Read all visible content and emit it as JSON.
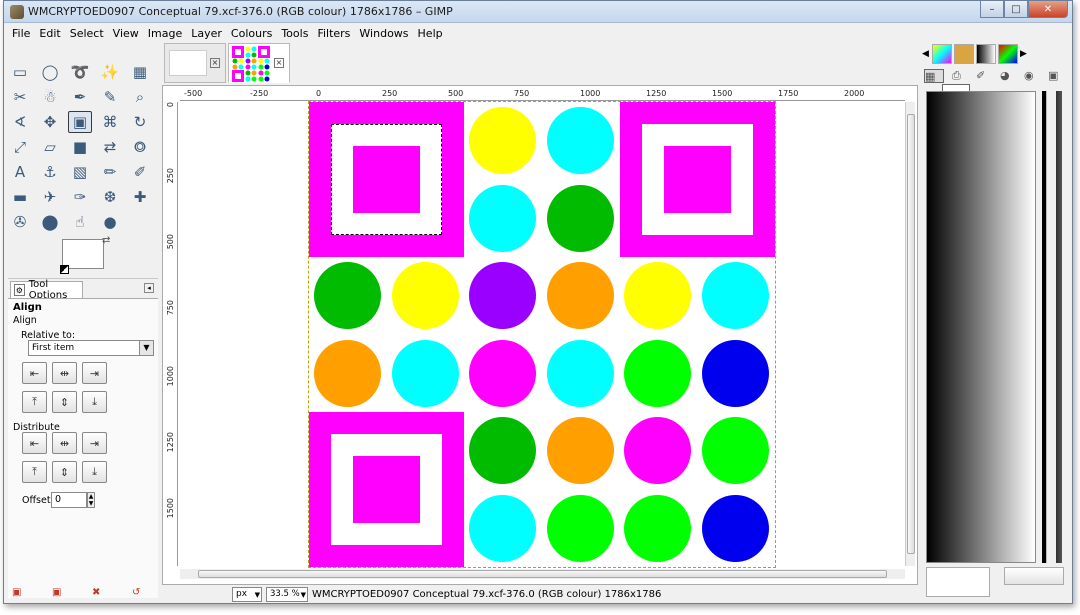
{
  "window": {
    "title": "WMCRYPTOED0907 Conceptual 79.xcf-376.0 (RGB colour) 1786x1786 – GIMP",
    "minimize": "–",
    "maximize": "□",
    "close": "✕"
  },
  "menu": [
    "File",
    "Edit",
    "Select",
    "View",
    "Image",
    "Layer",
    "Colours",
    "Tools",
    "Filters",
    "Windows",
    "Help"
  ],
  "tools": [
    "rect-select-icon",
    "ellipse-select-icon",
    "lasso-icon",
    "fuzzy-select-icon",
    "select-by-color-icon",
    "scissors-icon",
    "foreground-select-icon",
    "paths-icon",
    "color-picker-icon",
    "zoom-icon",
    "measure-icon",
    "move-icon",
    "align-icon",
    "crop-icon",
    "rotate-icon",
    "scale-icon",
    "shear-icon",
    "perspective-icon",
    "flip-icon",
    "cage-icon",
    "text-icon",
    "bucket-fill-icon",
    "blend-icon",
    "pencil-icon",
    "paintbrush-icon",
    "eraser-icon",
    "airbrush-icon",
    "ink-icon",
    "clone-icon",
    "heal-icon",
    "perspective-clone-icon",
    "blur-icon",
    "smudge-icon",
    "dodge-burn-icon"
  ],
  "tool_glyphs": [
    "▭",
    "◯",
    "➰",
    "✨",
    "▦",
    "✂",
    "☃",
    "✒",
    "✎",
    "⌕",
    "∢",
    "✥",
    "▣",
    "⌘",
    "↻",
    "⤢",
    "▱",
    "■",
    "⇄",
    "⭗",
    "A",
    "⚓",
    "▧",
    "✏",
    "✐",
    "▬",
    "✈",
    "✑",
    "❆",
    "✚",
    "✇",
    "⬤",
    "☝",
    "●"
  ],
  "tool_options": {
    "tab_label": "Tool Options",
    "heading": "Align",
    "subheading": "Align",
    "relative_to_label": "Relative to:",
    "relative_to_value": "First item",
    "distribute_label": "Distribute",
    "offset_label": "Offset:",
    "offset_value": "0"
  },
  "status": {
    "unit": "px",
    "zoom": "33.5 %",
    "text": "WMCRYPTOED0907 Conceptual 79.xcf-376.0 (RGB colour) 1786x1786"
  },
  "rulers": {
    "top": [
      "-500",
      "-250",
      "0",
      "250",
      "500",
      "750",
      "1000",
      "1250",
      "1500",
      "1750",
      "2000"
    ],
    "left": [
      "0",
      "250",
      "500",
      "750",
      "1000",
      "1250",
      "1500"
    ]
  },
  "colors": {
    "magenta": "#ff00ff",
    "yellow": "#ffff00",
    "cyan": "#00ffff",
    "green": "#00bb00",
    "lime": "#00ff00",
    "purple": "#9900ff",
    "orange": "#ffa000",
    "blue": "#0000ee"
  },
  "canvas": {
    "circles": [
      [
        "",
        "",
        "yellow",
        "cyan",
        "",
        ""
      ],
      [
        "",
        "",
        "cyan",
        "green",
        "",
        ""
      ],
      [
        "green",
        "yellow",
        "purple",
        "orange",
        "yellow",
        "cyan"
      ],
      [
        "orange",
        "cyan",
        "magenta",
        "cyan",
        "lime",
        "blue"
      ],
      [
        "",
        "",
        "green",
        "orange",
        "magenta",
        "lime"
      ],
      [
        "",
        "",
        "cyan",
        "lime",
        "lime",
        "blue"
      ]
    ]
  }
}
